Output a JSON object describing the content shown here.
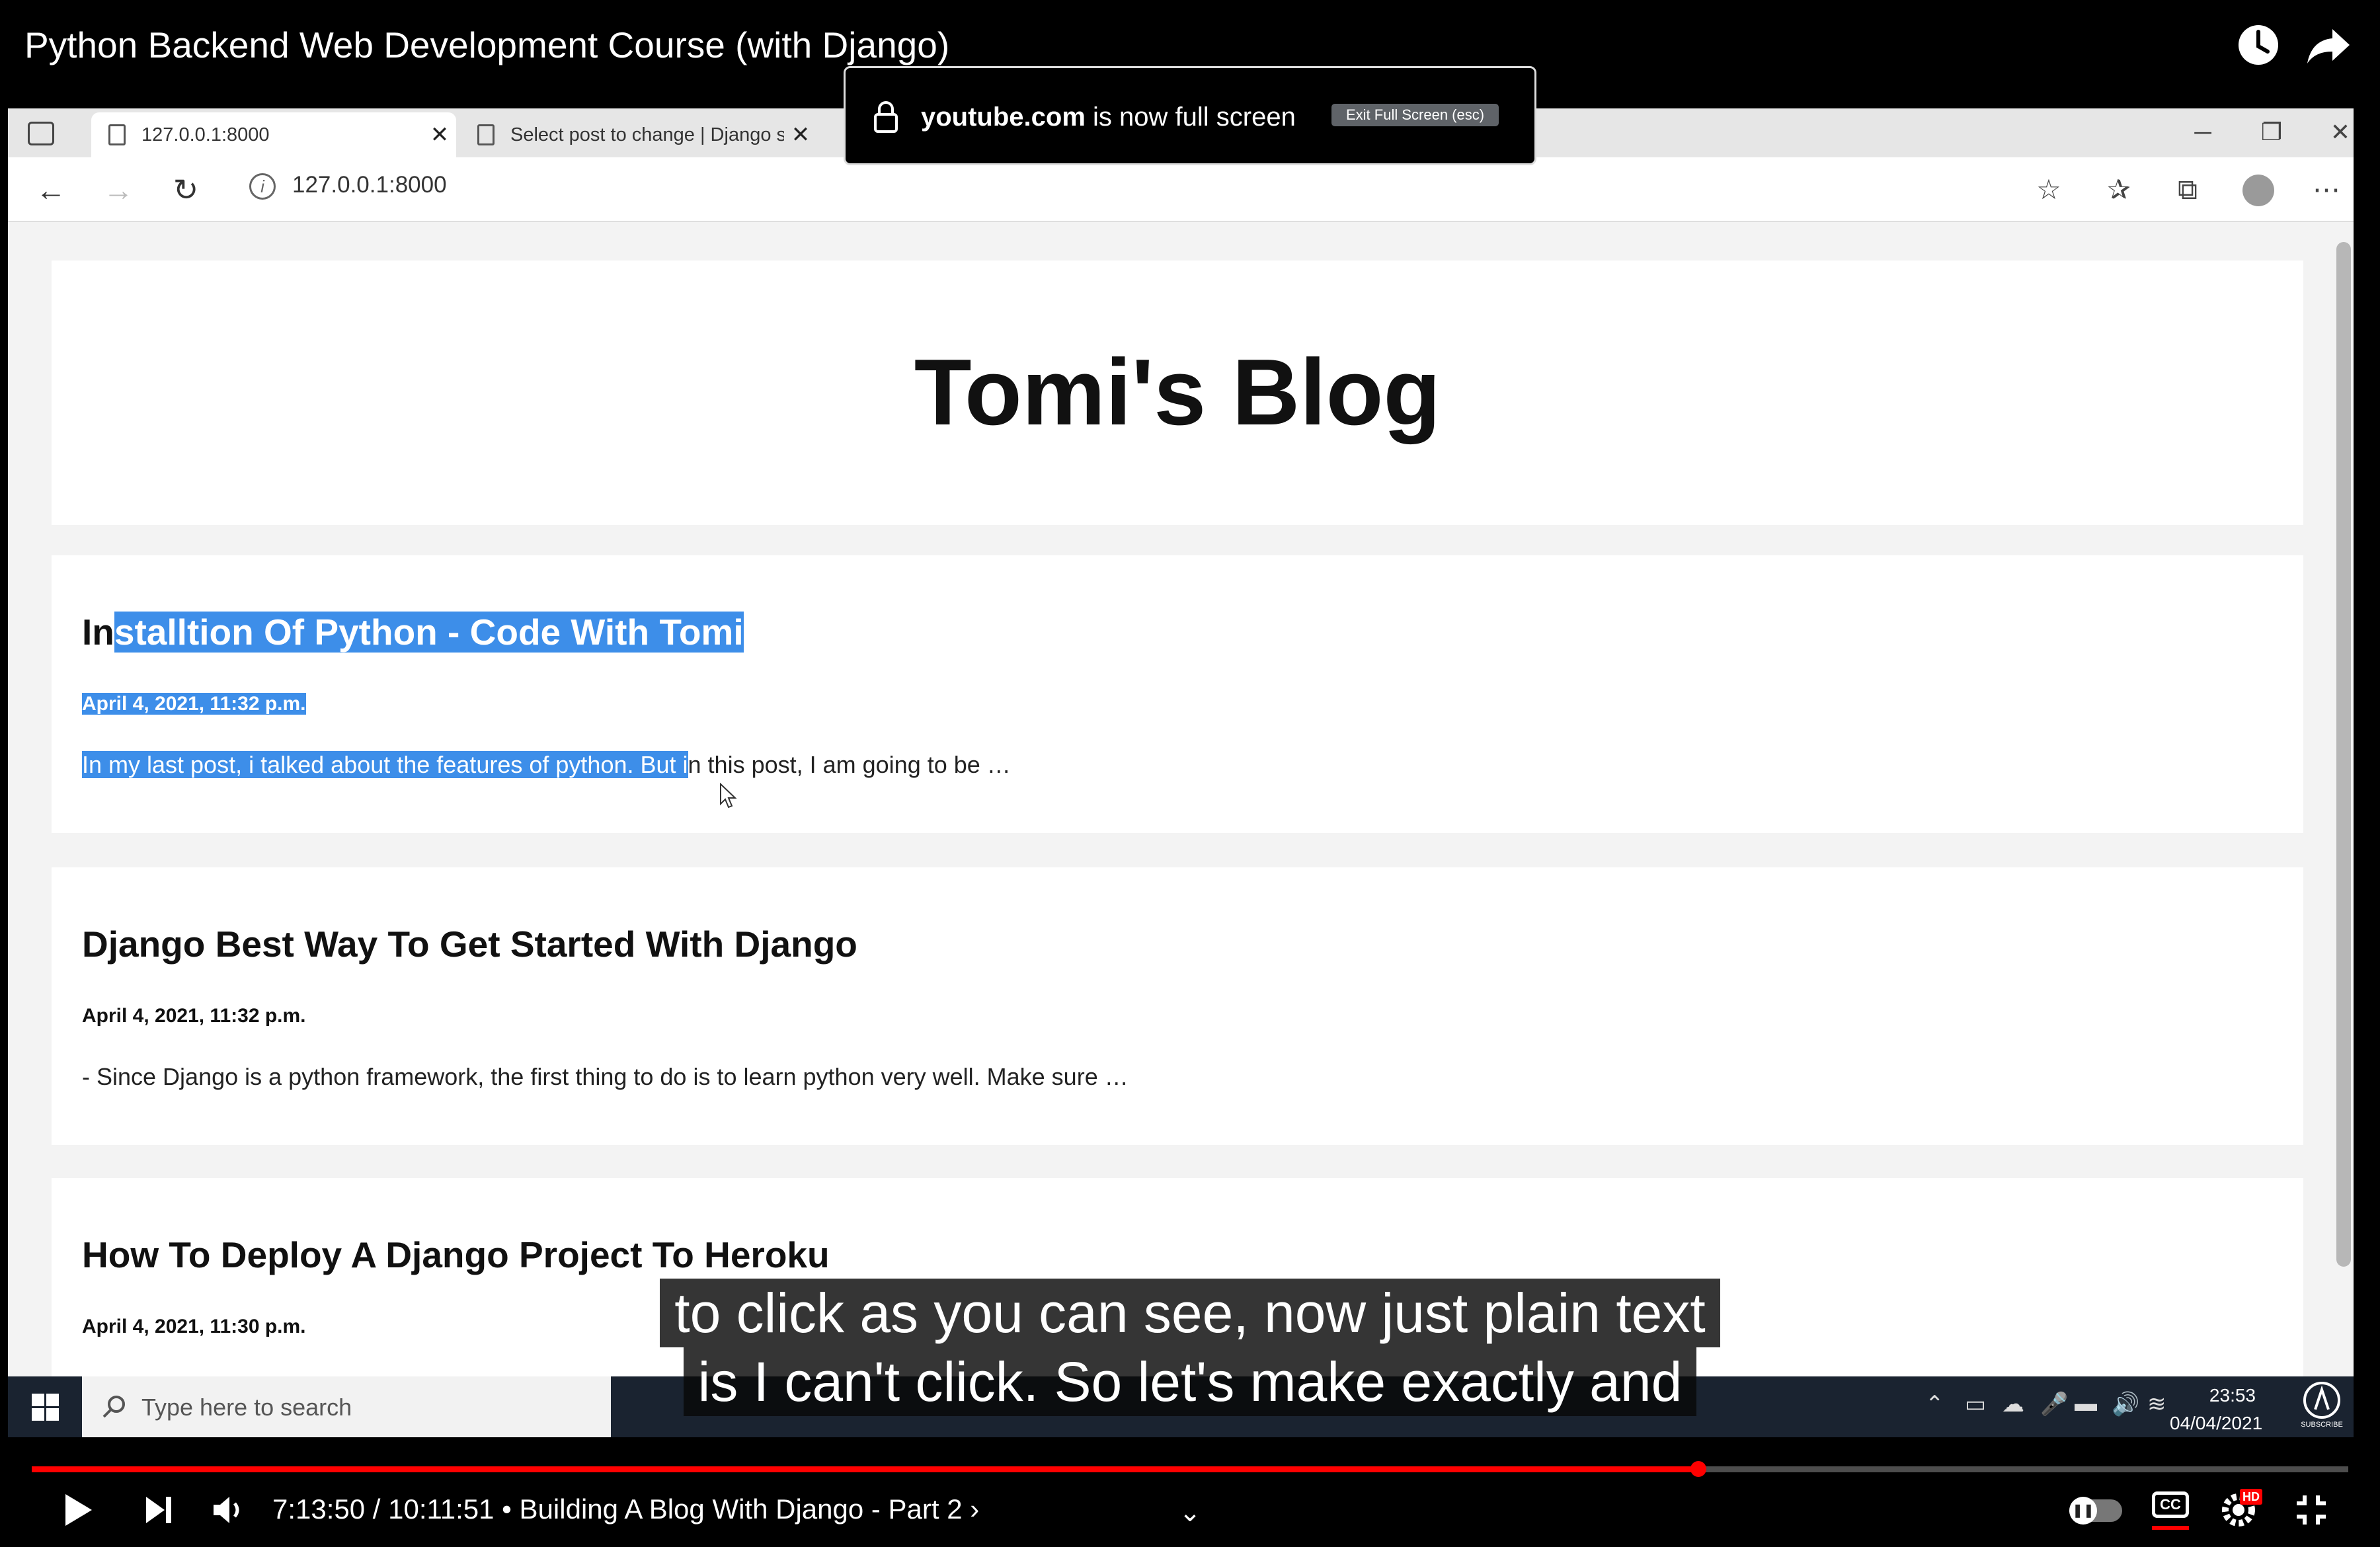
{
  "youtube": {
    "title": "Python Backend Web Development Course (with Django)",
    "watch_later_icon": "clock-icon",
    "share_icon": "share-arrow-icon"
  },
  "browser": {
    "tabs": [
      {
        "label": "127.0.0.1:8000",
        "active": true
      },
      {
        "label": "Select post to change | Django s",
        "active": false
      }
    ],
    "url": "127.0.0.1:8000"
  },
  "fullscreen_notice": {
    "domain": "youtube.com",
    "message": " is now full screen",
    "exit_label": "Exit Full Screen (esc)"
  },
  "blog": {
    "title": "Tomi's Blog",
    "posts": [
      {
        "title_unselected": "In",
        "title_selected": "stalltion Of Python - Code With Tomi",
        "date": "April 4, 2021, 11:32 p.m.",
        "excerpt_selected": "In my last post, i talked about the features of python. But i",
        "excerpt_unselected": "n this post, I am going to be …"
      },
      {
        "title": "Django Best Way To Get Started With Django",
        "date": "April 4, 2021, 11:32 p.m.",
        "excerpt": "- Since Django is a python framework, the first thing to do is to learn python very well. Make sure …"
      },
      {
        "title": "How To Deploy A Django Project To Heroku",
        "date": "April 4, 2021, 11:30 p.m."
      }
    ]
  },
  "taskbar": {
    "search_placeholder": "Type here to search",
    "time": "23:53",
    "date": "04/04/2021"
  },
  "subtitles": {
    "line1": "to click as you can see, now just plain text",
    "line2": "is I can't click. So let's make exactly and"
  },
  "player": {
    "time": "7:13:50 / 10:11:51",
    "chapter": " • Building A Blog With Django - Part 2 ›",
    "progress": 0.7195,
    "hd_badge": "HD",
    "subscribe_label": "SUBSCRIBE"
  },
  "colors": {
    "selection": "#3d8ee9",
    "progress": "#ff0000"
  }
}
